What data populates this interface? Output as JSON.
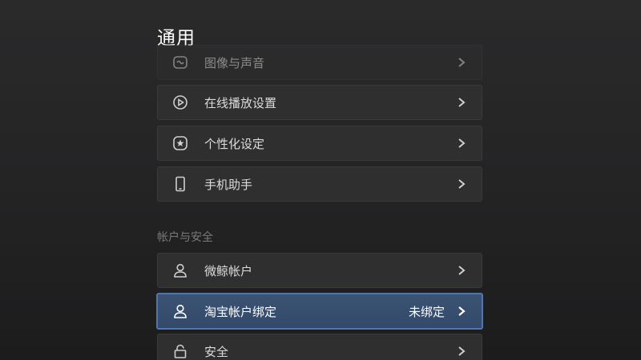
{
  "header": {
    "title": "通用"
  },
  "general_items": [
    {
      "label": "图像与声音",
      "icon": "image-sound-icon"
    },
    {
      "label": "在线播放设置",
      "icon": "play-circle-icon"
    },
    {
      "label": "个性化设定",
      "icon": "star-badge-icon"
    },
    {
      "label": "手机助手",
      "icon": "phone-icon"
    }
  ],
  "account_section": {
    "title": "帐户与安全",
    "items": [
      {
        "label": "微鲸帐户",
        "icon": "user-icon",
        "value": ""
      },
      {
        "label": "淘宝帐户绑定",
        "icon": "user-icon",
        "value": "未绑定"
      },
      {
        "label": "安全",
        "icon": "lock-icon",
        "value": ""
      }
    ]
  },
  "colors": {
    "background": "#252526",
    "row": "#2f2f30",
    "focused_row": "#3b5373",
    "focused_border": "#4e76b0",
    "section_text": "#7a7a7a"
  }
}
